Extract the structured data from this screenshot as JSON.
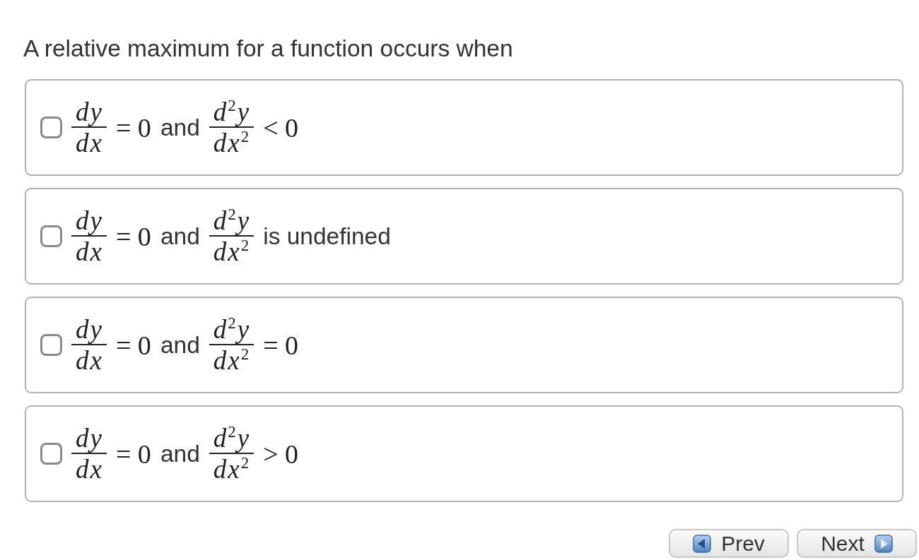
{
  "question": {
    "text": "A relative maximum for a function occurs when"
  },
  "options": [
    {
      "checked": false,
      "parts": [
        {
          "kind": "fraction",
          "numerator": "dy",
          "denominator": "dx"
        },
        {
          "kind": "math",
          "text": "= 0"
        },
        {
          "kind": "text",
          "text": "and"
        },
        {
          "kind": "fraction",
          "numerator": "d$^{2}$y",
          "denominator": "dx$^{2}$"
        },
        {
          "kind": "math",
          "text": "< 0"
        }
      ]
    },
    {
      "checked": false,
      "parts": [
        {
          "kind": "fraction",
          "numerator": "dy",
          "denominator": "dx"
        },
        {
          "kind": "math",
          "text": "= 0"
        },
        {
          "kind": "text",
          "text": "and"
        },
        {
          "kind": "fraction",
          "numerator": "d$^{2}$y",
          "denominator": "dx$^{2}$"
        },
        {
          "kind": "text",
          "text": "is undefined"
        }
      ]
    },
    {
      "checked": false,
      "parts": [
        {
          "kind": "fraction",
          "numerator": "dy",
          "denominator": "dx"
        },
        {
          "kind": "math",
          "text": "= 0"
        },
        {
          "kind": "text",
          "text": "and"
        },
        {
          "kind": "fraction",
          "numerator": "d$^{2}$y",
          "denominator": "dx$^{2}$"
        },
        {
          "kind": "math",
          "text": "= 0"
        }
      ]
    },
    {
      "checked": false,
      "parts": [
        {
          "kind": "fraction",
          "numerator": "dy",
          "denominator": "dx"
        },
        {
          "kind": "math",
          "text": "= 0"
        },
        {
          "kind": "text",
          "text": "and"
        },
        {
          "kind": "fraction",
          "numerator": "d$^{2}$y",
          "denominator": "dx$^{2}$"
        },
        {
          "kind": "math",
          "text": "> 0"
        }
      ]
    }
  ],
  "navigation": {
    "buttons": [
      {
        "kind": "prev",
        "label": "Prev"
      },
      {
        "kind": "next",
        "label": "Next"
      }
    ]
  }
}
